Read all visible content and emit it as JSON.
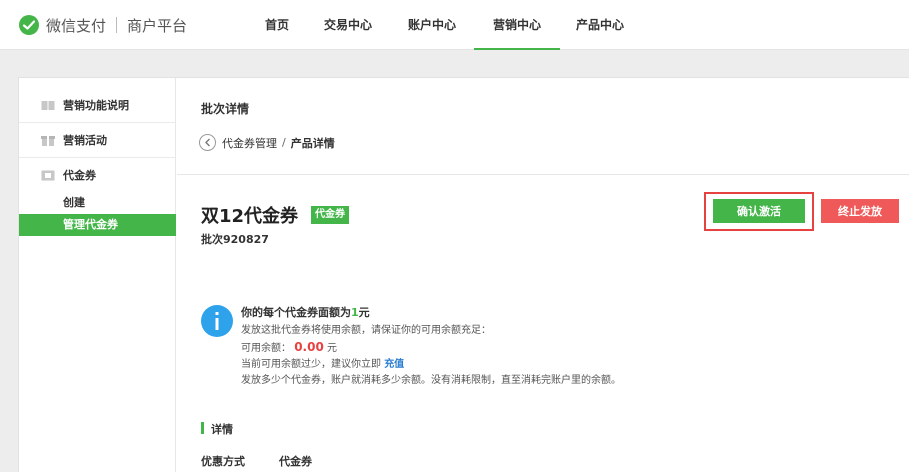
{
  "header": {
    "brand": "微信支付",
    "sub_brand": "商户平台",
    "nav": [
      {
        "label": "首页"
      },
      {
        "label": "交易中心"
      },
      {
        "label": "账户中心"
      },
      {
        "label": "营销中心"
      },
      {
        "label": "产品中心"
      }
    ],
    "active_nav": "营销中心"
  },
  "sidebar": {
    "groups": [
      {
        "label": "营销功能说明",
        "icon": "book-icon"
      },
      {
        "label": "营销活动",
        "icon": "gift-icon"
      },
      {
        "label": "代金券",
        "icon": "coupon-icon",
        "items": [
          {
            "label": "创建"
          },
          {
            "label": "管理代金券"
          }
        ]
      }
    ],
    "active_item": "管理代金券"
  },
  "main": {
    "page_title": "批次详情",
    "breadcrumb": {
      "parent": "代金券管理",
      "separator": "/",
      "current": "产品详情"
    },
    "coupon": {
      "title": "双12代金券",
      "tag": "代金券",
      "batch": "批次920827"
    },
    "buttons": {
      "activate": "确认激活",
      "stop": "终止发放"
    },
    "info": {
      "line1_prefix": "你的每个代金券面额为",
      "line1_amount": "1",
      "line1_suffix": "元",
      "line2": "发放这批代金券将使用余额，请保证你的可用余额充足：",
      "line3_label": "可用余额：",
      "line3_amount": "0.00",
      "line3_unit": "元",
      "line4_prefix": "当前可用余额过少，建议你立即",
      "line4_link": "充值",
      "line5": "发放多少个代金券，账户就消耗多少余额。没有消耗限制，直至消耗完账户里的余额。"
    },
    "details": {
      "section_title": "详情",
      "rows": [
        {
          "label": "优惠方式",
          "value": "代金券"
        }
      ]
    }
  },
  "colors": {
    "accent": "#44b549",
    "danger": "#f05959",
    "highlight": "#e64340",
    "link": "#2a7dd2"
  }
}
